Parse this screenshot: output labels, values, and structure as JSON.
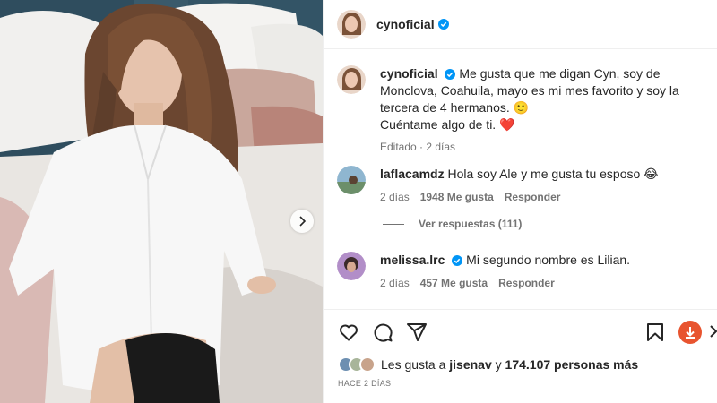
{
  "post": {
    "username": "cynoficial",
    "colors": {
      "verified": "#0095f6",
      "heart": "#ed4956",
      "download": "#e8542f"
    }
  },
  "caption": {
    "username": "cynoficial",
    "line1": "Me gusta que me digan Cyn, soy de Monclova, Coahuila, mayo es mi mes favorito y soy la tercera de 4 hermanos.",
    "emoji1": "🙂",
    "line2": "Cuéntame algo de ti.",
    "emoji2": "❤️",
    "meta": "Editado · 2 días"
  },
  "comments": [
    {
      "username": "laflacamdz",
      "text": "Hola soy Ale y me gusta tu esposo",
      "emoji": "😂",
      "time": "2 días",
      "likes": "1948 Me gusta",
      "reply": "Responder"
    },
    {
      "username": "melissa.lrc",
      "text": "Mi segundo nombre es Lilian.",
      "emoji": "",
      "time": "2 días",
      "likes": "457 Me gusta",
      "reply": "Responder"
    }
  ],
  "view_replies": "Ver respuestas (111)",
  "likes": {
    "prefix": "Les gusta a",
    "user": "jisenav",
    "joiner": "y",
    "count": "174.107 personas más"
  },
  "time_ago": "HACE 2 DÍAS",
  "icons": [
    "heart-icon",
    "comment-icon",
    "share-icon",
    "bookmark-icon",
    "download-icon",
    "next-arrow-icon",
    "verified-icon"
  ]
}
